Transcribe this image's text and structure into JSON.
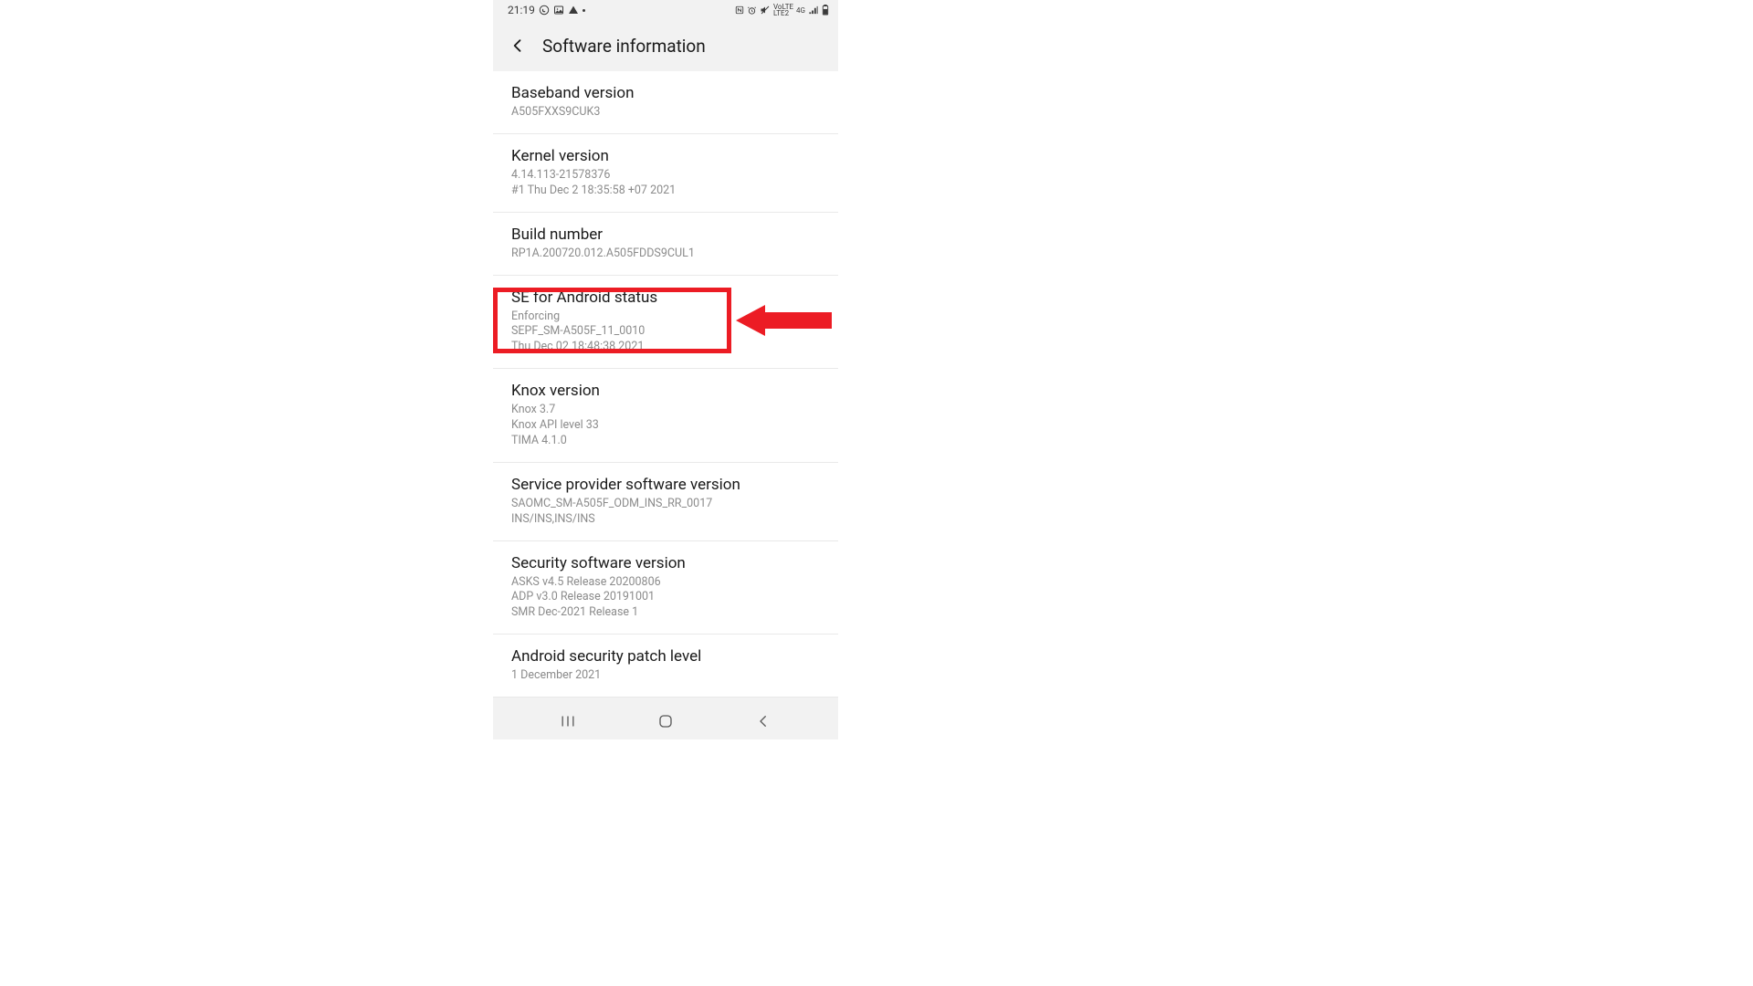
{
  "statusbar": {
    "time": "21:19",
    "whatsapp_icon": "whatsapp",
    "image_icon": "image",
    "warn_icon": "warning",
    "lte_text": "LTE2",
    "net_text": "4G"
  },
  "header": {
    "title": "Software information"
  },
  "rows": [
    {
      "label": "Baseband version",
      "sub": "A505FXXS9CUK3"
    },
    {
      "label": "Kernel version",
      "sub": "4.14.113-21578376\n#1 Thu Dec 2 18:35:58 +07 2021"
    },
    {
      "label": "Build number",
      "sub": "RP1A.200720.012.A505FDDS9CUL1"
    },
    {
      "label": "SE for Android status",
      "sub": "Enforcing\nSEPF_SM-A505F_11_0010\nThu Dec 02 18:48:38 2021"
    },
    {
      "label": "Knox version",
      "sub": "Knox 3.7\nKnox API level 33\nTIMA 4.1.0"
    },
    {
      "label": "Service provider software version",
      "sub": "SAOMC_SM-A505F_ODM_INS_RR_0017\nINS/INS,INS/INS"
    },
    {
      "label": "Security software version",
      "sub": "ASKS v4.5 Release 20200806\nADP v3.0 Release 20191001\nSMR Dec-2021 Release 1"
    },
    {
      "label": "Android security patch level",
      "sub": "1 December 2021"
    }
  ]
}
